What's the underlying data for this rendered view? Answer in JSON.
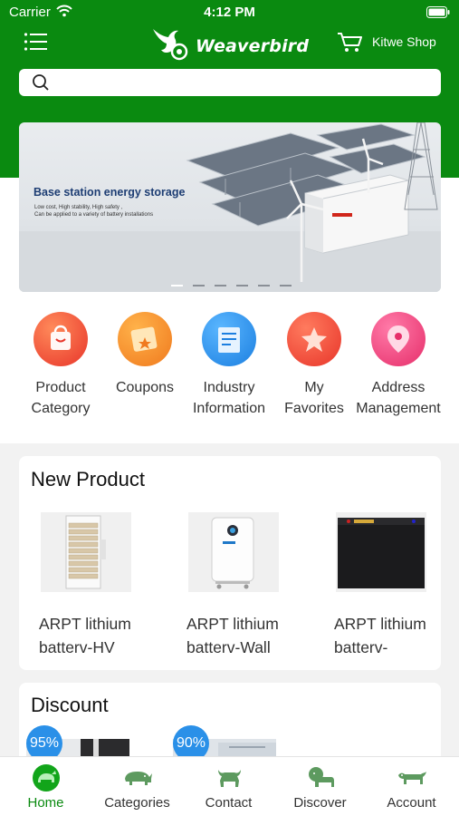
{
  "status_bar": {
    "carrier": "Carrier",
    "time": "4:12 PM"
  },
  "header": {
    "logo_text": "Weaverbird",
    "shop_label": "Kitwe Shop"
  },
  "search": {
    "placeholder": "",
    "value": ""
  },
  "banner": {
    "title": "Base station energy storage",
    "subtitle_line1": "Low cost, High stability, High safety ,",
    "subtitle_line2": "Can be applied to a variety of battery installations",
    "slide_count": 6,
    "active_slide": 1
  },
  "quick_menu": [
    {
      "line1": "Product",
      "line2": "Category",
      "icon": "bag-icon",
      "color": "#ee4a30"
    },
    {
      "line1": "Coupons",
      "line2": "",
      "icon": "ticket-icon",
      "color": "#f5872a"
    },
    {
      "line1": "Industry",
      "line2": "Information",
      "icon": "document-icon",
      "color": "#2b8de8"
    },
    {
      "line1": "My",
      "line2": "Favorites",
      "icon": "star-icon",
      "color": "#ef4637"
    },
    {
      "line1": "Address",
      "line2": "Management",
      "icon": "location-pin-icon",
      "color": "#ee3e78"
    }
  ],
  "new_product": {
    "title": "New Product",
    "items": [
      {
        "line1": "ARPT lithium",
        "line2": "batterv-HV"
      },
      {
        "line1": "ARPT lithium",
        "line2": "batterv-Wall"
      },
      {
        "line1": "ARPT lithium",
        "line2": "batterv-"
      }
    ]
  },
  "discount": {
    "title": "Discount",
    "items": [
      {
        "badge": "95%"
      },
      {
        "badge": "90%"
      }
    ]
  },
  "tab_bar": {
    "active": "home",
    "tabs": [
      {
        "key": "home",
        "label": "Home",
        "icon": "home-icon"
      },
      {
        "key": "categories",
        "label": "Categories",
        "icon": "rhino-icon"
      },
      {
        "key": "contact",
        "label": "Contact",
        "icon": "buffalo-icon"
      },
      {
        "key": "discover",
        "label": "Discover",
        "icon": "lion-icon"
      },
      {
        "key": "account",
        "label": "Account",
        "icon": "leopard-icon"
      }
    ]
  },
  "colors": {
    "brand_green": "#0a8a10",
    "badge_blue": "#2a90e8",
    "page_background": "#f2f2f2"
  }
}
